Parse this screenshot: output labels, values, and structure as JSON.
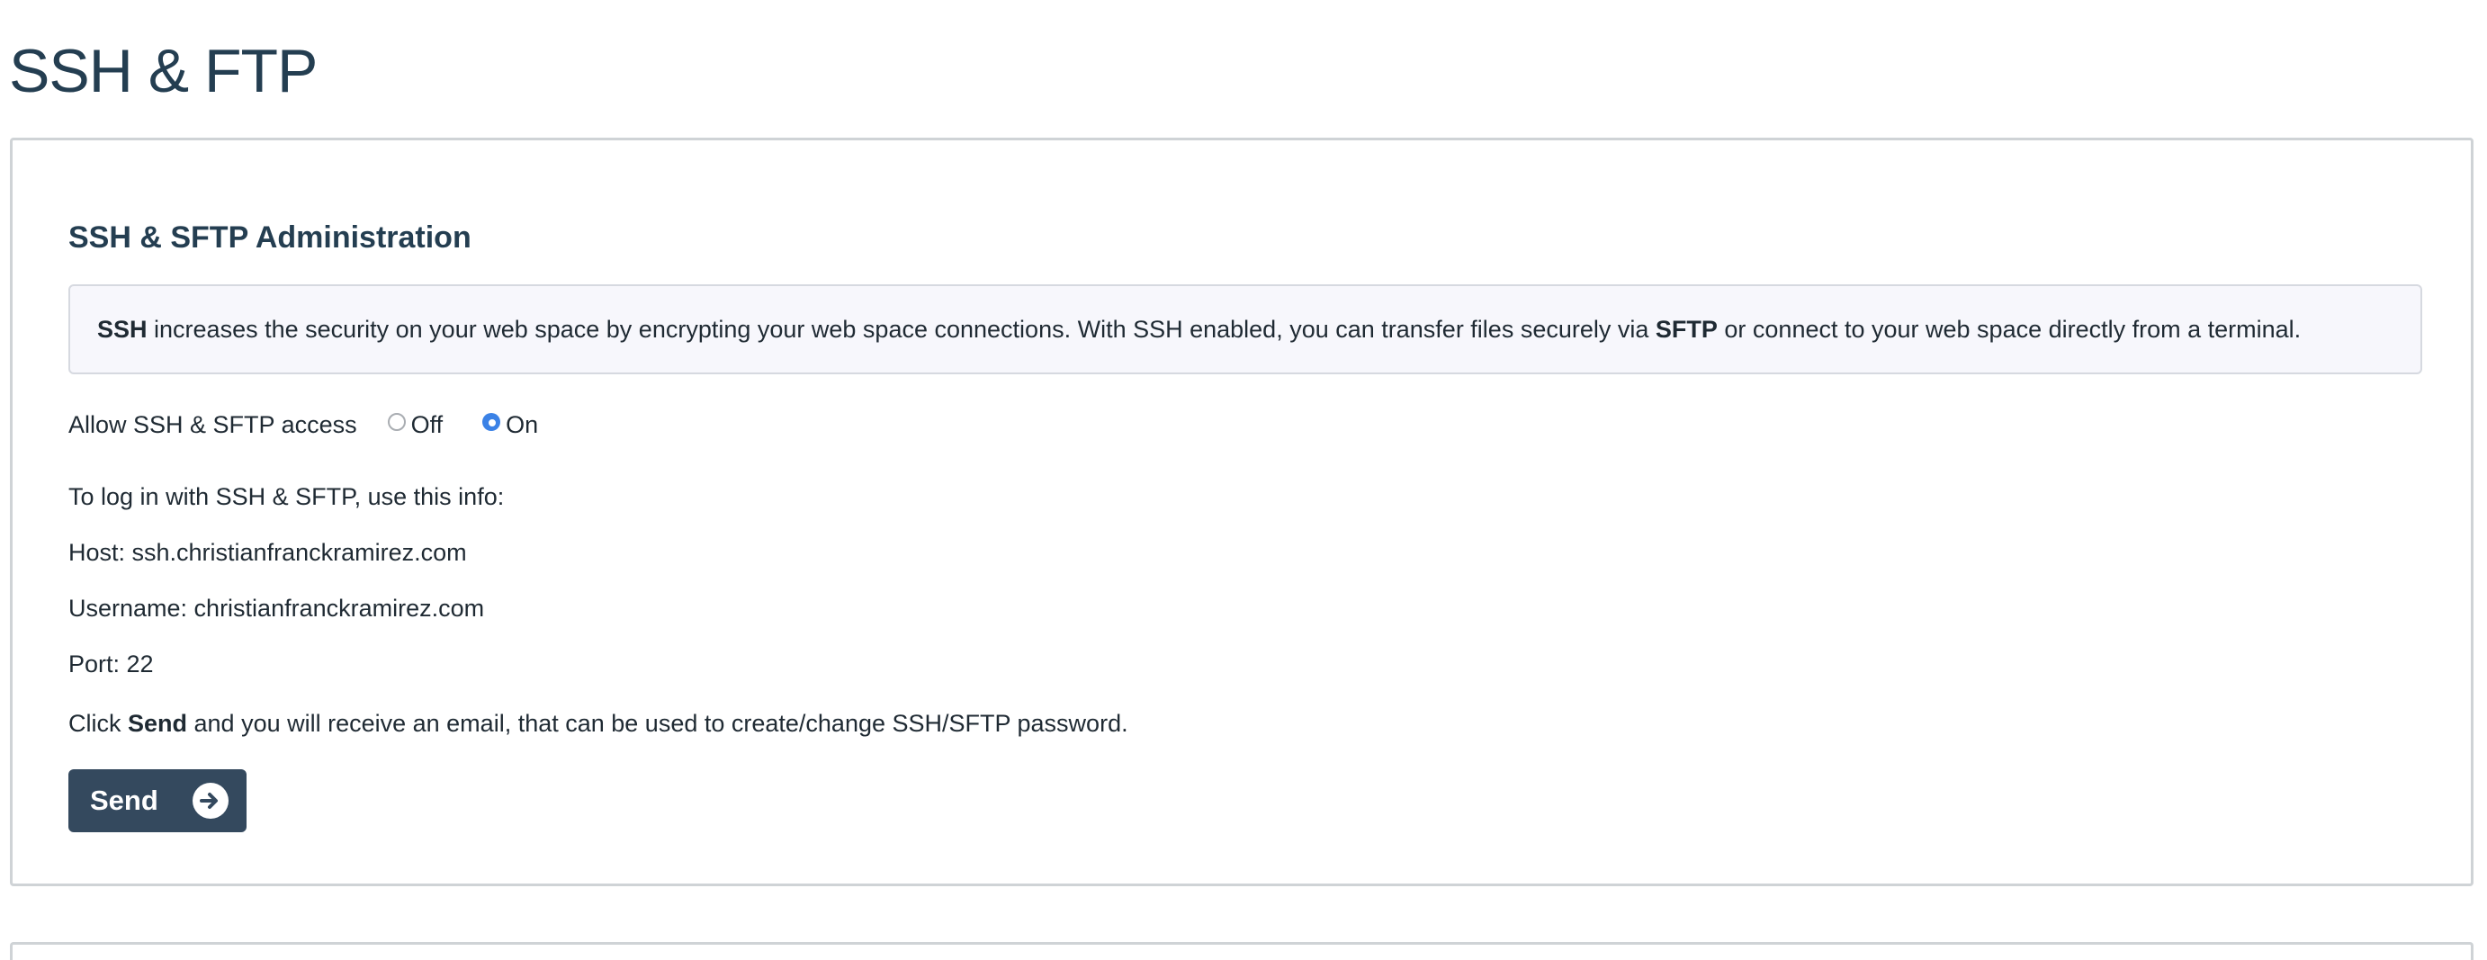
{
  "page": {
    "title": "SSH & FTP"
  },
  "panel": {
    "heading": "SSH & SFTP Administration",
    "info": {
      "ssh_term": "SSH",
      "text_1": " increases the security on your web space by encrypting your web space connections. With SSH enabled, you can transfer files securely via ",
      "sftp_term": "SFTP",
      "text_2": " or connect to your web space directly from a terminal."
    },
    "access": {
      "label": "Allow SSH & SFTP access",
      "options": [
        {
          "label": "Off",
          "checked": false
        },
        {
          "label": "On",
          "checked": true
        }
      ]
    },
    "login_intro": "To log in with SSH & SFTP, use this info:",
    "host": "Host: ssh.christianfranckramirez.com",
    "username": "Username: christianfranckramirez.com",
    "port": "Port: 22",
    "send_hint": {
      "prefix": "Click ",
      "bold": "Send",
      "suffix": " and you will receive an email, that can be used to create/change SSH/SFTP password."
    },
    "send_button": {
      "label": "Send",
      "icon": "arrow-right-circle-icon"
    }
  },
  "colors": {
    "heading": "#243e51",
    "button_bg": "#34495e",
    "radio_checked": "#3b82e6",
    "info_bg": "#f7f7fc"
  }
}
